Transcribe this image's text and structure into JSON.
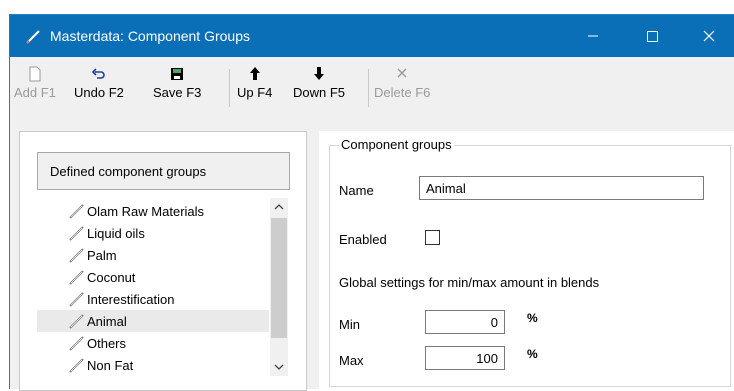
{
  "window": {
    "title": "Masterdata: Component Groups",
    "titlebar_color": "#0b6fb8"
  },
  "toolbar": {
    "add_label": "Add F1",
    "undo_label": "Undo F2",
    "save_label": "Save F3",
    "up_label": "Up F4",
    "down_label": "Down F5",
    "delete_label": "Delete F6"
  },
  "list": {
    "header": "Defined component groups",
    "items": [
      {
        "label": "Olam Raw Materials"
      },
      {
        "label": "Liquid oils"
      },
      {
        "label": "Palm"
      },
      {
        "label": "Coconut"
      },
      {
        "label": "Interestification"
      },
      {
        "label": "Animal"
      },
      {
        "label": "Others"
      },
      {
        "label": "Non Fat"
      }
    ],
    "selected_index": 5
  },
  "form": {
    "group_title": "Component groups",
    "name_label": "Name",
    "name_value": "Animal",
    "enabled_label": "Enabled",
    "enabled_checked": false,
    "global_settings_text": "Global settings for min/max amount in blends",
    "min_label": "Min",
    "min_value": "0",
    "max_label": "Max",
    "max_value": "100",
    "percent_symbol": "%"
  }
}
